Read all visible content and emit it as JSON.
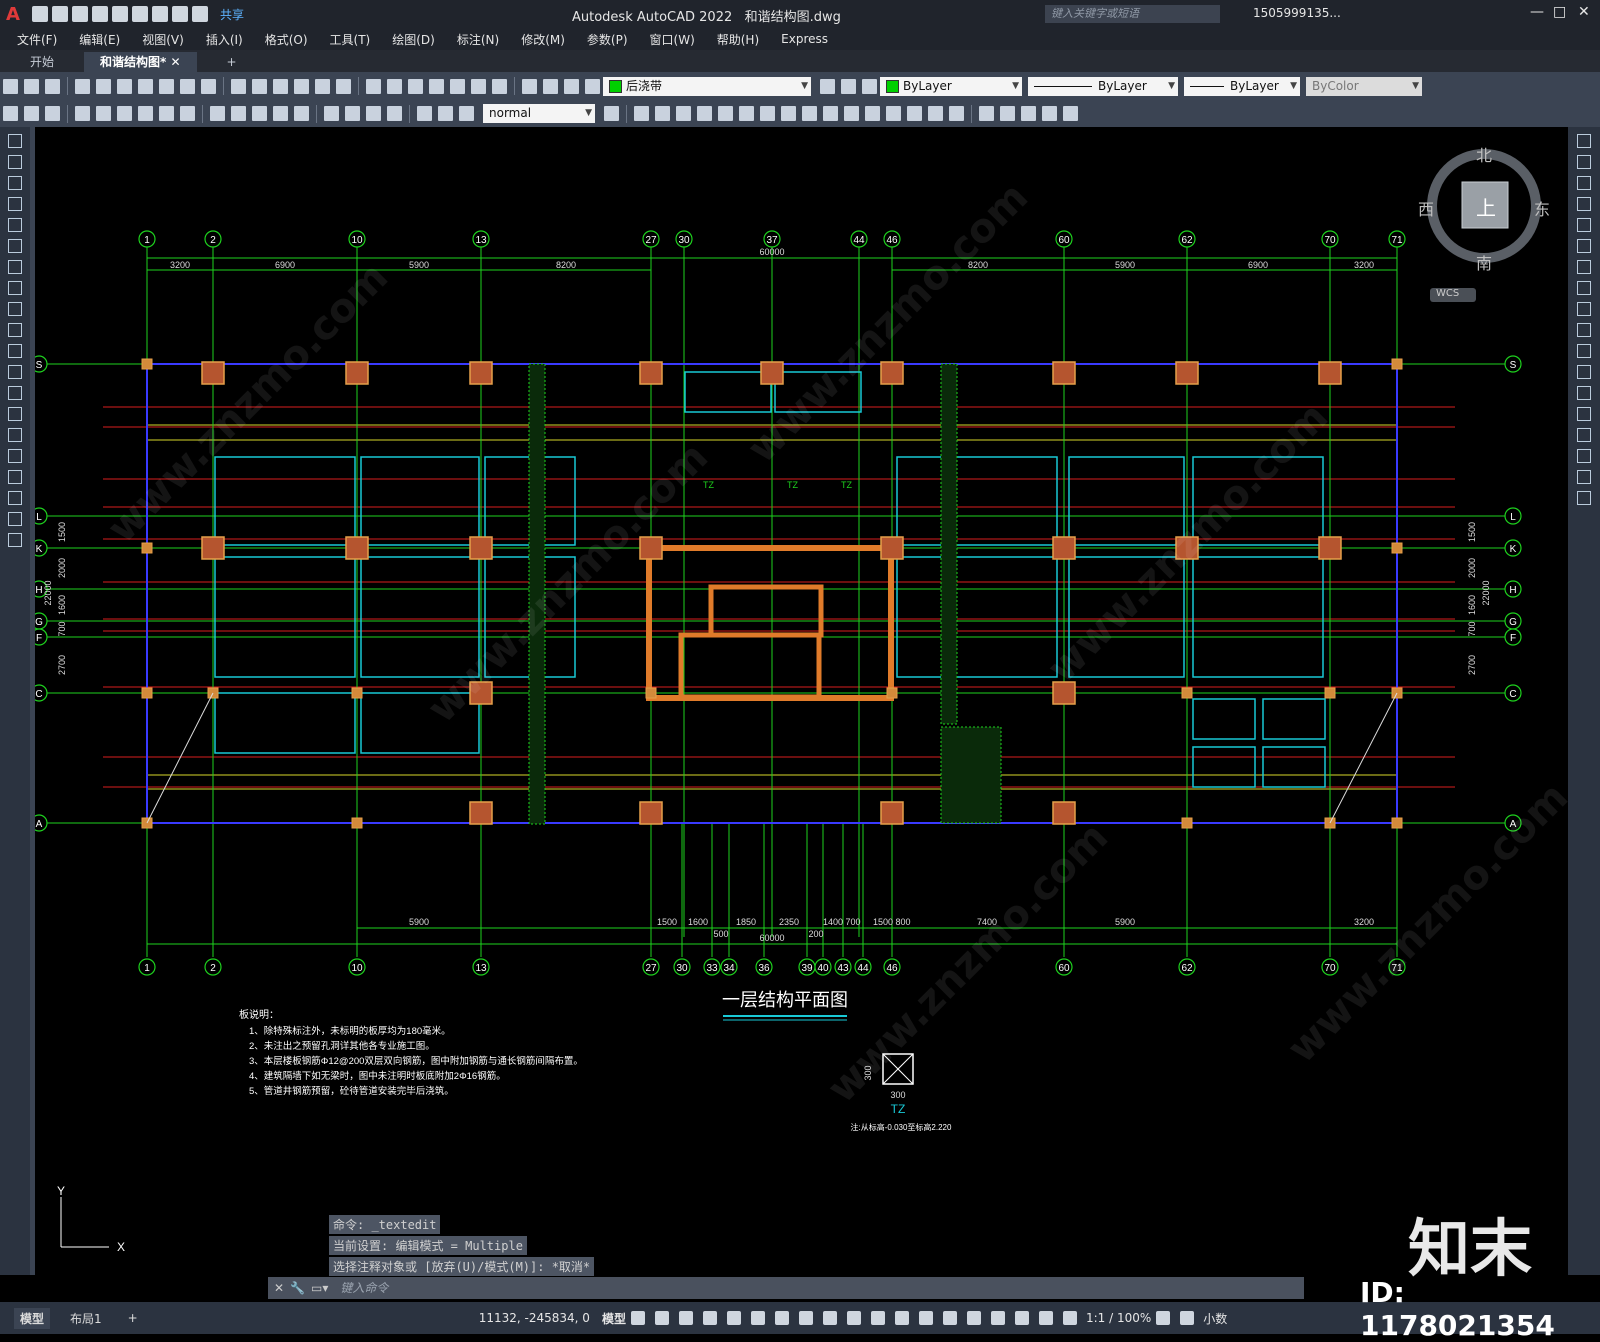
{
  "app": {
    "title": "Autodesk AutoCAD 2022",
    "filename": "和谐结构图.dwg",
    "share_label": "共享",
    "search_placeholder": "键入关键字或短语",
    "user": "1505999135...",
    "logo_letter": "A"
  },
  "menus": [
    "文件(F)",
    "编辑(E)",
    "视图(V)",
    "插入(I)",
    "格式(O)",
    "工具(T)",
    "绘图(D)",
    "标注(N)",
    "修改(M)",
    "参数(P)",
    "窗口(W)",
    "帮助(H)",
    "Express"
  ],
  "doc_tabs": [
    {
      "label": "开始",
      "active": false
    },
    {
      "label": "和谐结构图*",
      "active": true
    }
  ],
  "toolbar": {
    "layer_name": "后浇带",
    "color": "ByLayer",
    "linetype": "ByLayer",
    "lineweight": "ByLayer",
    "plotstyle": "ByColor",
    "textstyle": "normal",
    "layer_color": "#00d000"
  },
  "viewcube": {
    "north": "北",
    "south": "南",
    "east": "东",
    "west": "西",
    "top": "上",
    "wcs": "WCS"
  },
  "drawing": {
    "title": "一层结构平面图",
    "top_axes": [
      "1",
      "2",
      "10",
      "13",
      "27",
      "30",
      "37",
      "44",
      "46",
      "60",
      "62",
      "70",
      "71"
    ],
    "bottom_axes": [
      "1",
      "2",
      "10",
      "13",
      "27",
      "30",
      "33",
      "34",
      "36",
      "39",
      "40",
      "43",
      "44",
      "46",
      "60",
      "62",
      "70",
      "71"
    ],
    "row_axes": [
      "S",
      "L",
      "K",
      "H",
      "G",
      "F",
      "C",
      "A"
    ],
    "top_dims": [
      "3200",
      "6900",
      "5900",
      "8200",
      "8200",
      "5900",
      "6900",
      "3200"
    ],
    "total_dim": "60000",
    "bottom_dims": [
      "5900",
      "1500",
      "1600",
      "1850",
      "2350",
      "1400",
      "700",
      "1500",
      "800",
      "7400",
      "5900",
      "3200"
    ],
    "bottom_sub_dims": [
      "500",
      "200"
    ],
    "side_dims": [
      "1500",
      "2000",
      "1600",
      "700",
      "2700"
    ],
    "side_total": "22000",
    "beam_labels": [
      "TZ",
      "TZ",
      "TZ"
    ],
    "tz_detail": {
      "label": "TZ",
      "width": "300",
      "height": "300",
      "note": "注:从标高-0.030至标高2.220"
    },
    "notes_title": "板说明：",
    "notes": [
      "1、除特殊标注外，未标明的板厚均为180毫米。",
      "2、未注出之预留孔洞详其他各专业施工图。",
      "3、本层楼板钢筋Φ12@200双层双向钢筋，图中附加钢筋与通长钢筋间隔布置。",
      "4、建筑隔墙下如无梁时，图中未注明时板底附加2Φ16钢筋。",
      "5、管道井钢筋预留，砼待管道安装完毕后浇筑。"
    ]
  },
  "command": {
    "history": [
      "命令: _textedit",
      "当前设置: 编辑模式 = Multiple",
      "选择注释对象或 [放弃(U)/模式(M)]: *取消*"
    ],
    "input_placeholder": "键入命令"
  },
  "status": {
    "layout_tabs": [
      "模型",
      "布局1"
    ],
    "coords": "11132, -245834, 0",
    "model_label": "模型",
    "scale": "1:1 / 100%",
    "units": "小数"
  },
  "watermark": {
    "brand": "知末",
    "id": "ID: 1178021354",
    "site": "www.znzmo.com"
  }
}
